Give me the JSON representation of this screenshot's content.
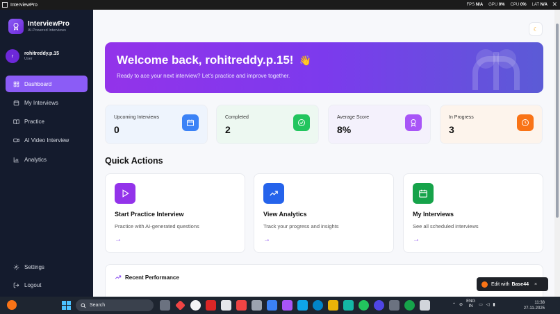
{
  "window": {
    "title": "InterviewPro",
    "metrics": {
      "fps_label": "FPS",
      "fps_value": "N/A",
      "gpu_label": "GPU",
      "gpu_value": "0%",
      "cpu_label": "CPU",
      "cpu_value": "0%",
      "lat_label": "LAT",
      "lat_value": "N/A"
    }
  },
  "brand": {
    "name": "InterviewPro",
    "tagline": "AI-Powered Interviews"
  },
  "user": {
    "initial": "r",
    "name": "rohitreddy.p.15",
    "role": "User"
  },
  "nav": [
    {
      "label": "Dashboard",
      "icon": "dashboard-icon",
      "active": true
    },
    {
      "label": "My Interviews",
      "icon": "calendar-icon",
      "active": false
    },
    {
      "label": "Practice",
      "icon": "book-icon",
      "active": false
    },
    {
      "label": "AI Video Interview",
      "icon": "video-icon",
      "active": false
    },
    {
      "label": "Analytics",
      "icon": "bar-chart-icon",
      "active": false
    }
  ],
  "nav_bottom": [
    {
      "label": "Settings",
      "icon": "gear-icon"
    },
    {
      "label": "Logout",
      "icon": "logout-icon"
    }
  ],
  "hero": {
    "title": "Welcome back, rohitreddy.p.15!",
    "emoji": "👋",
    "subtitle": "Ready to ace your next interview? Let's practice and improve together."
  },
  "stats": [
    {
      "label": "Upcoming Interviews",
      "value": "0",
      "icon": "calendar-icon",
      "color": "#3b82f6",
      "bg": "#eef4fd"
    },
    {
      "label": "Completed",
      "value": "2",
      "icon": "check-circle-icon",
      "color": "#22c55e",
      "bg": "#edf8f1"
    },
    {
      "label": "Average Score",
      "value": "8%",
      "icon": "award-icon",
      "color": "#a855f7",
      "bg": "#f4f1fc"
    },
    {
      "label": "In Progress",
      "value": "3",
      "icon": "clock-icon",
      "color": "#f97316",
      "bg": "#fdf4ec"
    }
  ],
  "quick_actions": {
    "title": "Quick Actions",
    "items": [
      {
        "title": "Start Practice Interview",
        "desc": "Practice with AI-generated questions",
        "icon": "play-icon",
        "color": "#9333ea",
        "arrow": "→"
      },
      {
        "title": "View Analytics",
        "desc": "Track your progress and insights",
        "icon": "trending-up-icon",
        "color": "#2563eb",
        "arrow": "→"
      },
      {
        "title": "My Interviews",
        "desc": "See all scheduled interviews",
        "icon": "calendar-icon",
        "color": "#16a34a",
        "arrow": "→"
      }
    ]
  },
  "recent": {
    "title": "Recent Performance"
  },
  "badge": {
    "prefix": "Edit with",
    "brand": "Base44",
    "close": "×"
  },
  "theme_toggle": {
    "icon": "moon-icon",
    "glyph": "☾"
  },
  "taskbar": {
    "search_placeholder": "Search",
    "lang_top": "ENG",
    "lang_bottom": "IN",
    "time": "11:38",
    "date": "27-11-2025"
  }
}
